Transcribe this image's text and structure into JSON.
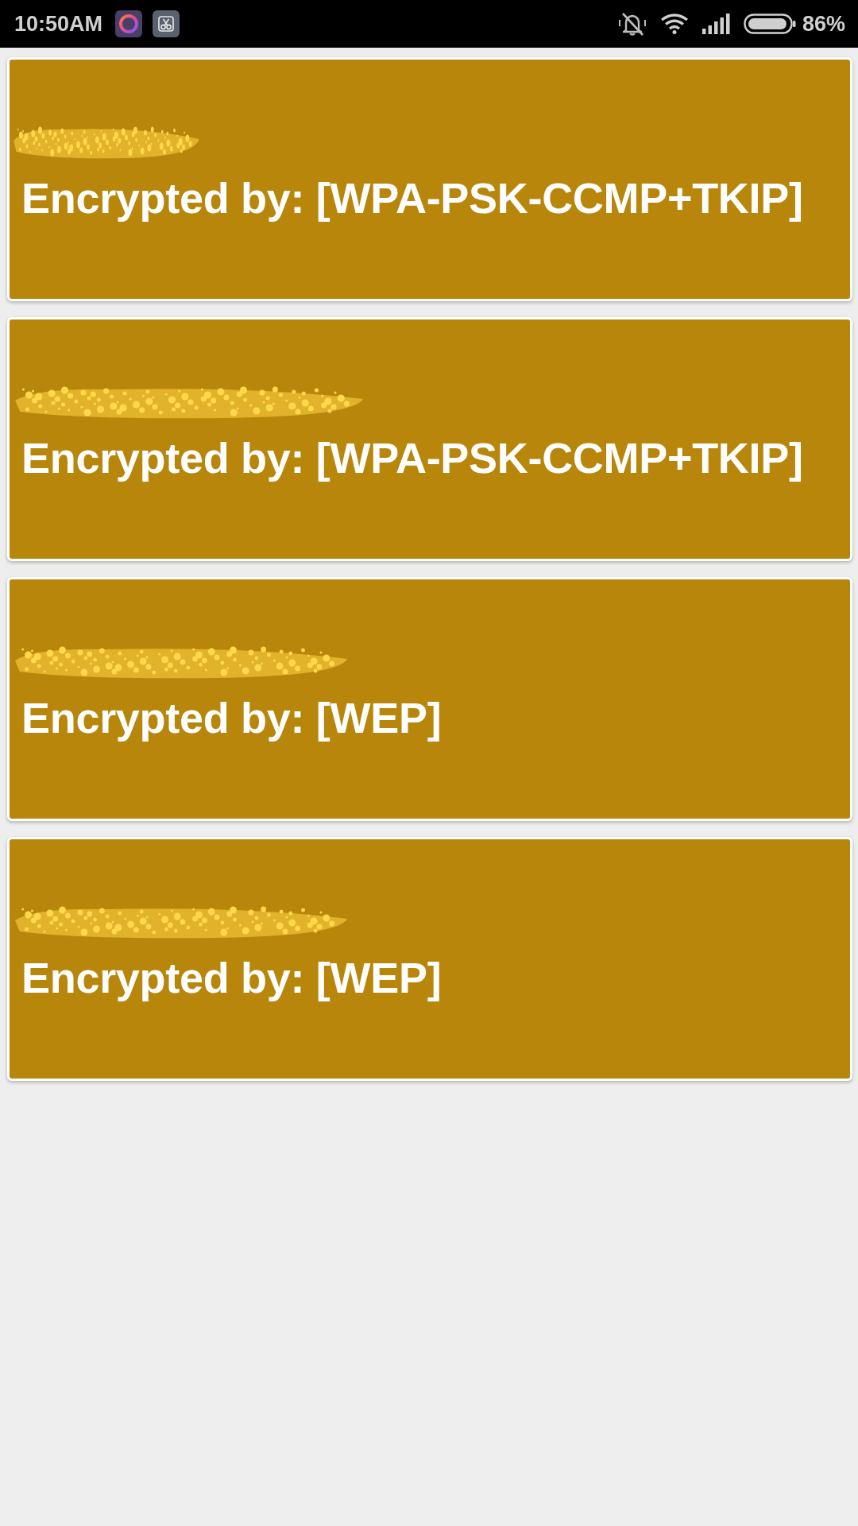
{
  "status_bar": {
    "time": "10:50AM",
    "battery": "86%"
  },
  "networks": [
    {
      "name_redacted": true,
      "encryption": "Encrypted by: [WPA-PSK-CCMP+TKIP]"
    },
    {
      "name_redacted": true,
      "encryption": "Encrypted by: [WPA-PSK-CCMP+TKIP]"
    },
    {
      "name_redacted": true,
      "encryption": "Encrypted by: [WEP]"
    },
    {
      "name_redacted": true,
      "encryption": "Encrypted by: [WEP]"
    }
  ]
}
